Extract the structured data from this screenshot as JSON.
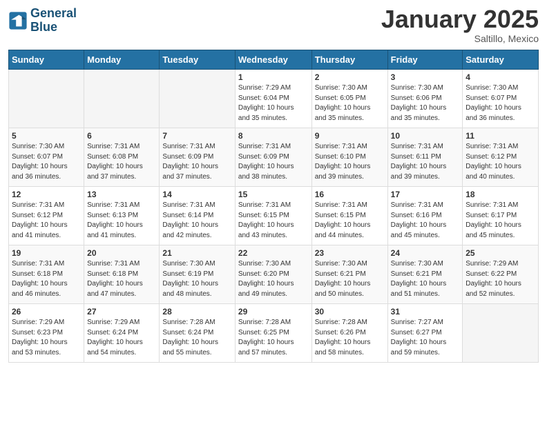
{
  "header": {
    "logo_line1": "General",
    "logo_line2": "Blue",
    "month": "January 2025",
    "location": "Saltillo, Mexico"
  },
  "weekdays": [
    "Sunday",
    "Monday",
    "Tuesday",
    "Wednesday",
    "Thursday",
    "Friday",
    "Saturday"
  ],
  "weeks": [
    [
      {
        "day": "",
        "info": ""
      },
      {
        "day": "",
        "info": ""
      },
      {
        "day": "",
        "info": ""
      },
      {
        "day": "1",
        "info": "Sunrise: 7:29 AM\nSunset: 6:04 PM\nDaylight: 10 hours\nand 35 minutes."
      },
      {
        "day": "2",
        "info": "Sunrise: 7:30 AM\nSunset: 6:05 PM\nDaylight: 10 hours\nand 35 minutes."
      },
      {
        "day": "3",
        "info": "Sunrise: 7:30 AM\nSunset: 6:06 PM\nDaylight: 10 hours\nand 35 minutes."
      },
      {
        "day": "4",
        "info": "Sunrise: 7:30 AM\nSunset: 6:07 PM\nDaylight: 10 hours\nand 36 minutes."
      }
    ],
    [
      {
        "day": "5",
        "info": "Sunrise: 7:30 AM\nSunset: 6:07 PM\nDaylight: 10 hours\nand 36 minutes."
      },
      {
        "day": "6",
        "info": "Sunrise: 7:31 AM\nSunset: 6:08 PM\nDaylight: 10 hours\nand 37 minutes."
      },
      {
        "day": "7",
        "info": "Sunrise: 7:31 AM\nSunset: 6:09 PM\nDaylight: 10 hours\nand 37 minutes."
      },
      {
        "day": "8",
        "info": "Sunrise: 7:31 AM\nSunset: 6:09 PM\nDaylight: 10 hours\nand 38 minutes."
      },
      {
        "day": "9",
        "info": "Sunrise: 7:31 AM\nSunset: 6:10 PM\nDaylight: 10 hours\nand 39 minutes."
      },
      {
        "day": "10",
        "info": "Sunrise: 7:31 AM\nSunset: 6:11 PM\nDaylight: 10 hours\nand 39 minutes."
      },
      {
        "day": "11",
        "info": "Sunrise: 7:31 AM\nSunset: 6:12 PM\nDaylight: 10 hours\nand 40 minutes."
      }
    ],
    [
      {
        "day": "12",
        "info": "Sunrise: 7:31 AM\nSunset: 6:12 PM\nDaylight: 10 hours\nand 41 minutes."
      },
      {
        "day": "13",
        "info": "Sunrise: 7:31 AM\nSunset: 6:13 PM\nDaylight: 10 hours\nand 41 minutes."
      },
      {
        "day": "14",
        "info": "Sunrise: 7:31 AM\nSunset: 6:14 PM\nDaylight: 10 hours\nand 42 minutes."
      },
      {
        "day": "15",
        "info": "Sunrise: 7:31 AM\nSunset: 6:15 PM\nDaylight: 10 hours\nand 43 minutes."
      },
      {
        "day": "16",
        "info": "Sunrise: 7:31 AM\nSunset: 6:15 PM\nDaylight: 10 hours\nand 44 minutes."
      },
      {
        "day": "17",
        "info": "Sunrise: 7:31 AM\nSunset: 6:16 PM\nDaylight: 10 hours\nand 45 minutes."
      },
      {
        "day": "18",
        "info": "Sunrise: 7:31 AM\nSunset: 6:17 PM\nDaylight: 10 hours\nand 45 minutes."
      }
    ],
    [
      {
        "day": "19",
        "info": "Sunrise: 7:31 AM\nSunset: 6:18 PM\nDaylight: 10 hours\nand 46 minutes."
      },
      {
        "day": "20",
        "info": "Sunrise: 7:31 AM\nSunset: 6:18 PM\nDaylight: 10 hours\nand 47 minutes."
      },
      {
        "day": "21",
        "info": "Sunrise: 7:30 AM\nSunset: 6:19 PM\nDaylight: 10 hours\nand 48 minutes."
      },
      {
        "day": "22",
        "info": "Sunrise: 7:30 AM\nSunset: 6:20 PM\nDaylight: 10 hours\nand 49 minutes."
      },
      {
        "day": "23",
        "info": "Sunrise: 7:30 AM\nSunset: 6:21 PM\nDaylight: 10 hours\nand 50 minutes."
      },
      {
        "day": "24",
        "info": "Sunrise: 7:30 AM\nSunset: 6:21 PM\nDaylight: 10 hours\nand 51 minutes."
      },
      {
        "day": "25",
        "info": "Sunrise: 7:29 AM\nSunset: 6:22 PM\nDaylight: 10 hours\nand 52 minutes."
      }
    ],
    [
      {
        "day": "26",
        "info": "Sunrise: 7:29 AM\nSunset: 6:23 PM\nDaylight: 10 hours\nand 53 minutes."
      },
      {
        "day": "27",
        "info": "Sunrise: 7:29 AM\nSunset: 6:24 PM\nDaylight: 10 hours\nand 54 minutes."
      },
      {
        "day": "28",
        "info": "Sunrise: 7:28 AM\nSunset: 6:24 PM\nDaylight: 10 hours\nand 55 minutes."
      },
      {
        "day": "29",
        "info": "Sunrise: 7:28 AM\nSunset: 6:25 PM\nDaylight: 10 hours\nand 57 minutes."
      },
      {
        "day": "30",
        "info": "Sunrise: 7:28 AM\nSunset: 6:26 PM\nDaylight: 10 hours\nand 58 minutes."
      },
      {
        "day": "31",
        "info": "Sunrise: 7:27 AM\nSunset: 6:27 PM\nDaylight: 10 hours\nand 59 minutes."
      },
      {
        "day": "",
        "info": ""
      }
    ]
  ]
}
